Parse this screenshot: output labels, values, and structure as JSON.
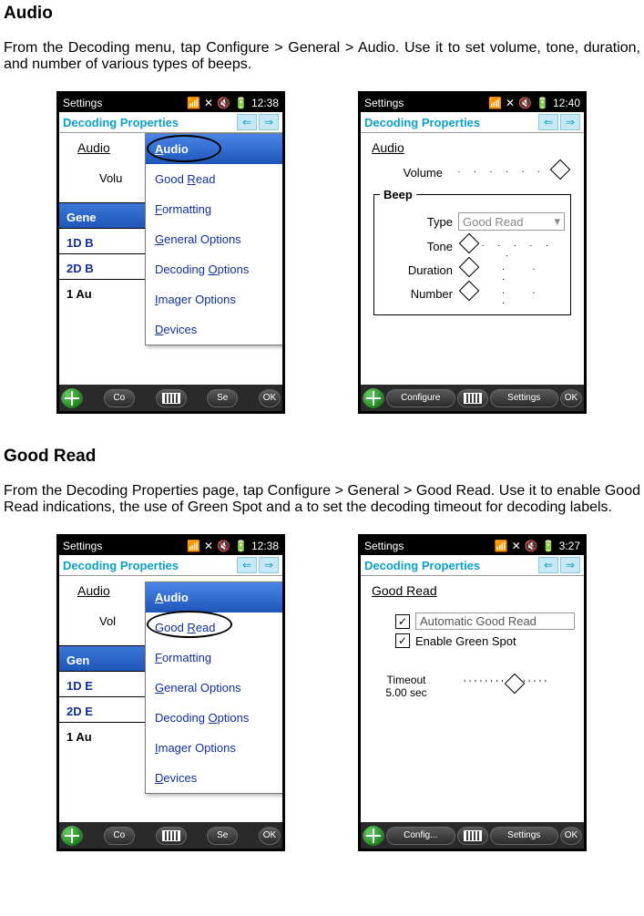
{
  "sections": {
    "audio": {
      "heading": "Audio",
      "body": "From the Decoding menu, tap Configure > General > Audio. Use it to set volume, tone, duration, and number of various types of beeps."
    },
    "goodread": {
      "heading": "Good Read",
      "body": "From the Decoding Properties page, tap Configure > General > Good Read. Use it to enable Good Read indications, the use of Green Spot and a to set the decoding timeout for decoding labels."
    }
  },
  "common": {
    "settings": "Settings",
    "decoding_properties": "Decoding Properties"
  },
  "times": {
    "t1238": "12:38",
    "t1240": "12:40",
    "t327": "3:27"
  },
  "menu": {
    "items": [
      {
        "label": "Audio",
        "key": "A"
      },
      {
        "label": "Good Read",
        "key": "R"
      },
      {
        "label": "Formatting",
        "key": "F"
      },
      {
        "label": "General Options",
        "key": "G"
      },
      {
        "label": "Decoding Options",
        "key": "O"
      },
      {
        "label": "Imager Options",
        "key": "I"
      },
      {
        "label": "Devices",
        "key": "D"
      }
    ]
  },
  "left_panel": {
    "audio_label": "Audio",
    "volume_short": "Volu",
    "vol_short2": "Vol",
    "tabs": {
      "gen": "Gene",
      "gen2": "Gen",
      "b1d": "1D B",
      "b1d2": "1D E",
      "b2d": "2D B",
      "b2d2": "2D E",
      "au": "1 Au"
    }
  },
  "audio_settings": {
    "title": "Audio",
    "volume": "Volume",
    "beep_legend": "Beep",
    "type": "Type",
    "type_value": "Good Read",
    "tone": "Tone",
    "duration": "Duration",
    "number": "Number"
  },
  "goodread_settings": {
    "title": "Good Read",
    "auto": "Automatic Good Read",
    "green": "Enable Green Spot",
    "timeout_label": "Timeout",
    "timeout_value": "5.00 sec"
  },
  "softbar": {
    "configure": "Configure",
    "settings": "Settings",
    "ok": "OK",
    "config_short": "Config...",
    "co": "Co",
    "se": "Se"
  }
}
